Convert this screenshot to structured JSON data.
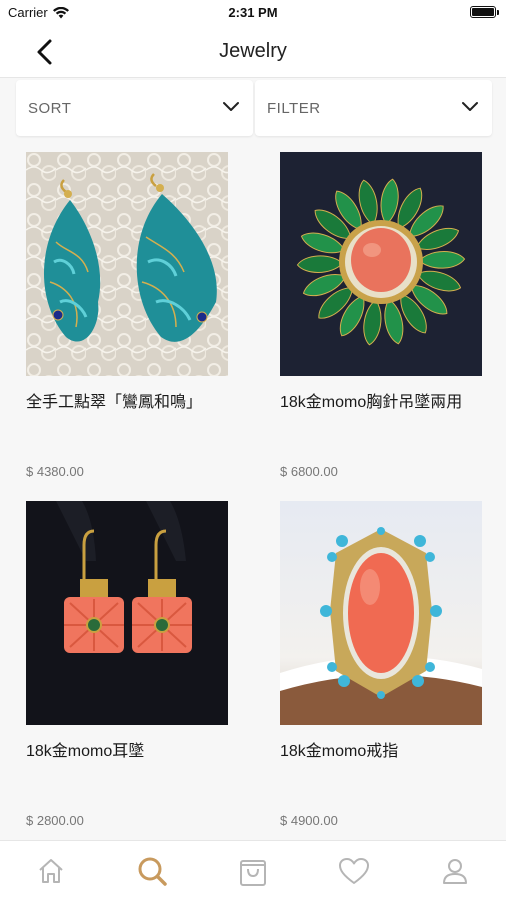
{
  "status_bar": {
    "carrier": "Carrier",
    "time": "2:31 PM",
    "battery_level": 1.0
  },
  "nav": {
    "title": "Jewelry"
  },
  "controls": {
    "sort_label": "SORT",
    "filter_label": "FILTER"
  },
  "products": [
    {
      "name": "全手工點翠「鸞鳳和鳴」",
      "price": "$ 4380.00"
    },
    {
      "name": "18k金momo胸針吊墜兩用",
      "price": "$ 6800.00"
    },
    {
      "name": "18k金momo耳墜",
      "price": "$ 2800.00"
    },
    {
      "name": "18k金momo戒指",
      "price": "$ 4900.00"
    }
  ],
  "tabs": [
    {
      "icon": "home-icon",
      "active": false
    },
    {
      "icon": "search-icon",
      "active": true
    },
    {
      "icon": "shopping-bag-icon",
      "active": false
    },
    {
      "icon": "heart-icon",
      "active": false
    },
    {
      "icon": "user-icon",
      "active": false
    }
  ],
  "colors": {
    "accent": "#c89a5e",
    "inactive_icon": "#b5b5b5",
    "background": "#f7f7f7"
  }
}
